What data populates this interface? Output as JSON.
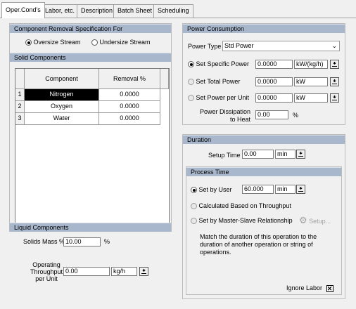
{
  "tabs": [
    "Oper.Cond's",
    "Labor, etc.",
    "Description",
    "Batch Sheet",
    "Scheduling"
  ],
  "component_removal": {
    "header": "Component Removal Specification For",
    "options": [
      "Oversize Stream",
      "Undersize Stream"
    ],
    "selected": "Oversize Stream"
  },
  "solid_components": {
    "header": "Solid Components",
    "columns": [
      "Component",
      "Removal %"
    ],
    "rows": [
      {
        "index": "1",
        "component": "Nitrogen",
        "removal": "0.0000"
      },
      {
        "index": "2",
        "component": "Oxygen",
        "removal": "0.0000"
      },
      {
        "index": "3",
        "component": "Water",
        "removal": "0.0000"
      }
    ]
  },
  "liquid_components": {
    "header": "Liquid Components",
    "solids_mass_label": "Solids Mass %",
    "solids_mass_value": "10.00",
    "solids_mass_unit": "%"
  },
  "throughput": {
    "label_line1": "Operating",
    "label_line2": "Throughput",
    "label_line3": "per Unit",
    "value": "0.00",
    "unit": "kg/h"
  },
  "power": {
    "header": "Power Consumption",
    "type_label": "Power Type",
    "type_value": "Std Power",
    "options": [
      {
        "label": "Set Specific Power",
        "value": "0.0000",
        "unit": "kW/(kg/h)",
        "selected": true
      },
      {
        "label": "Set Total Power",
        "value": "0.0000",
        "unit": "kW",
        "selected": false
      },
      {
        "label": "Set Power per Unit",
        "value": "0.0000",
        "unit": "kW",
        "selected": false
      }
    ],
    "dissipation_label1": "Power Dissipation",
    "dissipation_label2": "to Heat",
    "dissipation_value": "0.00",
    "dissipation_unit": "%"
  },
  "duration": {
    "header": "Duration",
    "setup_label": "Setup Time",
    "setup_value": "0.00",
    "setup_unit": "min"
  },
  "process_time": {
    "header": "Process Time",
    "by_user_label": "Set by User",
    "by_user_value": "60.000",
    "by_user_unit": "min",
    "throughput_label": "Calculated Based on Throughput",
    "master_slave_label": "Set by Master-Slave Relationship",
    "setup_button": "Setup...",
    "note": "Match the duration of this operation to the duration of another operation or string of operations."
  },
  "ignore_label": "Ignore Labor"
}
